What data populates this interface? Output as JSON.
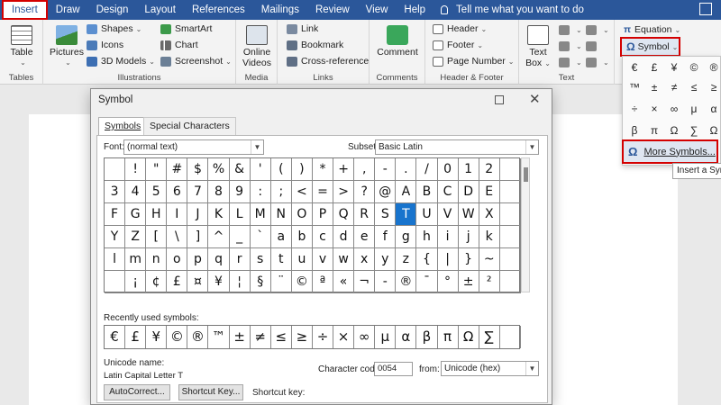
{
  "tabs": [
    "Insert",
    "Draw",
    "Design",
    "Layout",
    "References",
    "Mailings",
    "Review",
    "View",
    "Help"
  ],
  "tell_me": "Tell me what you want to do",
  "ribbon": {
    "table": "Table",
    "tables_label": "Tables",
    "pictures": "Pictures",
    "shapes": "Shapes",
    "icons": "Icons",
    "models3d": "3D Models",
    "smartart": "SmartArt",
    "chart": "Chart",
    "screenshot": "Screenshot",
    "illustrations_label": "Illustrations",
    "online_videos_1": "Online",
    "online_videos_2": "Videos",
    "media_label": "Media",
    "link": "Link",
    "bookmark": "Bookmark",
    "cross_reference": "Cross-reference",
    "links_label": "Links",
    "comment": "Comment",
    "comments_label": "Comments",
    "header": "Header",
    "footer": "Footer",
    "page_number": "Page Number",
    "header_footer_label": "Header & Footer",
    "text_box_1": "Text",
    "text_box_2": "Box",
    "text_label": "Text",
    "equation": "Equation",
    "symbol": "Symbol"
  },
  "gallery": {
    "symbols": [
      "€",
      "£",
      "¥",
      "©",
      "®",
      "™",
      "±",
      "≠",
      "≤",
      "≥",
      "÷",
      "×",
      "∞",
      "μ",
      "α",
      "β",
      "π",
      "Ω",
      "∑",
      "Ω"
    ],
    "more_symbols": "More Symbols...",
    "tooltip": "Insert a Sym"
  },
  "dialog": {
    "title": "Symbol",
    "tabs": [
      "Symbols",
      "Special Characters"
    ],
    "font_label": "Font:",
    "font_value": "(normal text)",
    "subset_label": "Subset:",
    "subset_value": "Basic Latin",
    "grid": [
      " ",
      "!",
      "\"",
      "#",
      "$",
      "%",
      "&",
      "'",
      "(",
      ")",
      "*",
      "+",
      ",",
      "-",
      ".",
      "/",
      "0",
      "1",
      "2",
      "",
      "3",
      "4",
      "5",
      "6",
      "7",
      "8",
      "9",
      ":",
      ";",
      "<",
      "=",
      ">",
      "?",
      "@",
      "A",
      "B",
      "C",
      "D",
      "E",
      "",
      "F",
      "G",
      "H",
      "I",
      "J",
      "K",
      "L",
      "M",
      "N",
      "O",
      "P",
      "Q",
      "R",
      "S",
      "T",
      "U",
      "V",
      "W",
      "X",
      "",
      "Y",
      "Z",
      "[",
      "\\",
      "]",
      "^",
      "_",
      "`",
      "a",
      "b",
      "c",
      "d",
      "e",
      "f",
      "g",
      "h",
      "i",
      "j",
      "k",
      "",
      "l",
      "m",
      "n",
      "o",
      "p",
      "q",
      "r",
      "s",
      "t",
      "u",
      "v",
      "w",
      "x",
      "y",
      "z",
      "{",
      "|",
      "}",
      "~",
      "",
      " ",
      "¡",
      "¢",
      "£",
      "¤",
      "¥",
      "¦",
      "§",
      "¨",
      "©",
      "ª",
      "«",
      "¬",
      "-",
      "®",
      "¯",
      "°",
      "±",
      "²",
      ""
    ],
    "selected_symbol": "T",
    "recent_label": "Recently used symbols:",
    "recent": [
      "€",
      "£",
      "¥",
      "©",
      "®",
      "™",
      "±",
      "≠",
      "≤",
      "≥",
      "÷",
      "×",
      "∞",
      "μ",
      "α",
      "β",
      "π",
      "Ω",
      "∑",
      ""
    ],
    "unicode_name_label": "Unicode name:",
    "unicode_name": "Latin Capital Letter T",
    "char_code_label": "Character code:",
    "char_code": "0054",
    "from_label": "from:",
    "from_value": "Unicode (hex)",
    "autocorrect_btn": "AutoCorrect...",
    "shortcut_btn": "Shortcut Key...",
    "shortcut_key_label": "Shortcut key:"
  },
  "ruler_marks": [
    "1",
    "2",
    "3",
    "4"
  ]
}
